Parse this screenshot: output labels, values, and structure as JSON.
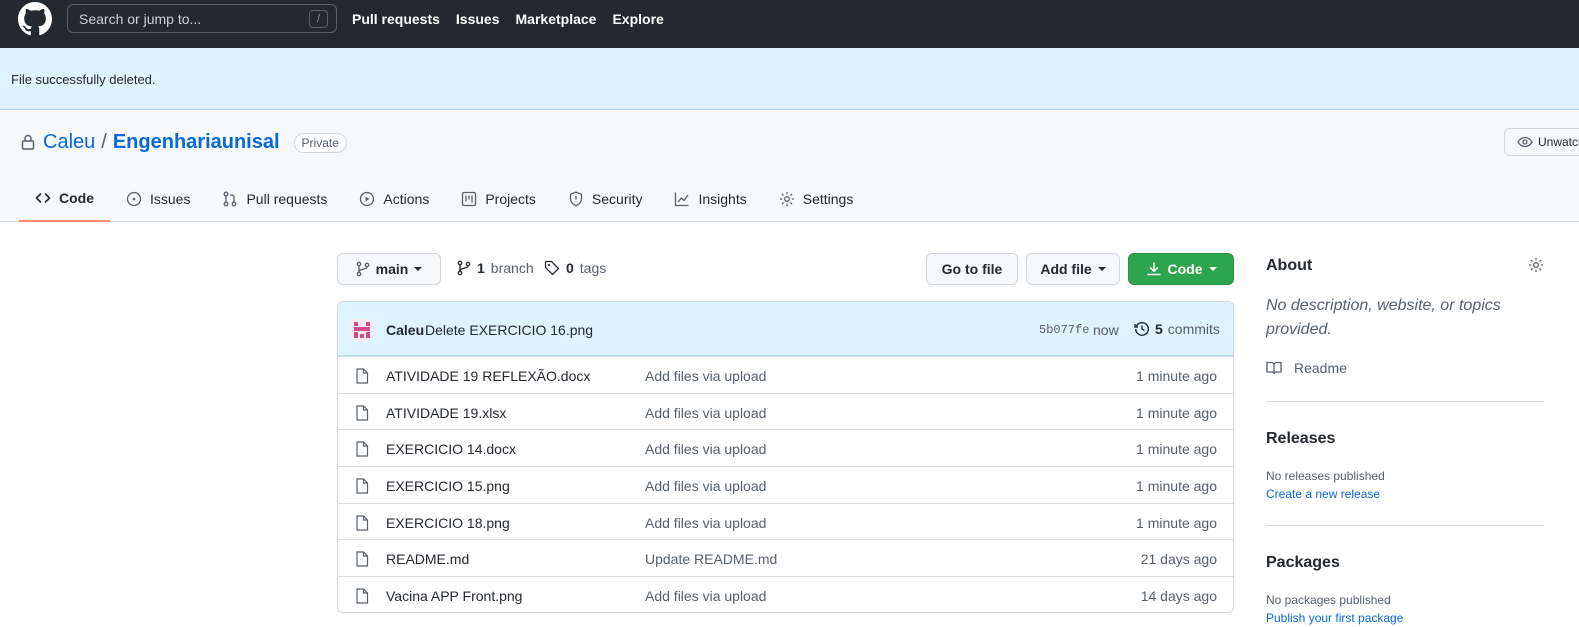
{
  "header": {
    "search_placeholder": "Search or jump to...",
    "search_shortcut": "/",
    "nav": [
      "Pull requests",
      "Issues",
      "Marketplace",
      "Explore"
    ]
  },
  "flash": {
    "message": "File successfully deleted."
  },
  "repo": {
    "owner": "Caleu",
    "separator": "/",
    "name": "Engenhariaunisal",
    "visibility": "Private",
    "watch_label": "Unwatch"
  },
  "tabs": [
    {
      "label": "Code",
      "icon": "code-icon",
      "active": true
    },
    {
      "label": "Issues",
      "icon": "issue-icon"
    },
    {
      "label": "Pull requests",
      "icon": "pull-request-icon"
    },
    {
      "label": "Actions",
      "icon": "play-icon"
    },
    {
      "label": "Projects",
      "icon": "project-icon"
    },
    {
      "label": "Security",
      "icon": "shield-icon"
    },
    {
      "label": "Insights",
      "icon": "graph-icon"
    },
    {
      "label": "Settings",
      "icon": "gear-icon"
    }
  ],
  "toolbar": {
    "branch": "main",
    "branch_count": "1",
    "branch_label": "branch",
    "tag_count": "0",
    "tag_label": "tags",
    "go_to_file": "Go to file",
    "add_file": "Add file",
    "code": "Code"
  },
  "latest_commit": {
    "author": "Caleu",
    "message": "Delete EXERCICIO 16.png",
    "sha": "5b077fe",
    "when": "now",
    "commit_count": "5",
    "commit_label": "commits"
  },
  "files": [
    {
      "name": "ATIVIDADE 19 REFLEXÃO.docx",
      "message": "Add files via upload",
      "age": "1 minute ago"
    },
    {
      "name": "ATIVIDADE 19.xlsx",
      "message": "Add files via upload",
      "age": "1 minute ago"
    },
    {
      "name": "EXERCICIO 14.docx",
      "message": "Add files via upload",
      "age": "1 minute ago"
    },
    {
      "name": "EXERCICIO 15.png",
      "message": "Add files via upload",
      "age": "1 minute ago"
    },
    {
      "name": "EXERCICIO 18.png",
      "message": "Add files via upload",
      "age": "1 minute ago"
    },
    {
      "name": "README.md",
      "message": "Update README.md",
      "age": "21 days ago"
    },
    {
      "name": "Vacina APP Front.png",
      "message": "Add files via upload",
      "age": "14 days ago"
    }
  ],
  "sidebar": {
    "about_title": "About",
    "about_desc": "No description, website, or topics provided.",
    "readme_label": "Readme",
    "releases_title": "Releases",
    "releases_none": "No releases published",
    "releases_link": "Create a new release",
    "packages_title": "Packages",
    "packages_none": "No packages published",
    "packages_link": "Publish your first package"
  },
  "colors": {
    "header_bg": "#24292f",
    "flash_bg": "#ddf4ff",
    "link": "#0969da",
    "primary_button": "#2da44e",
    "active_tab_underline": "#fd8c73"
  }
}
